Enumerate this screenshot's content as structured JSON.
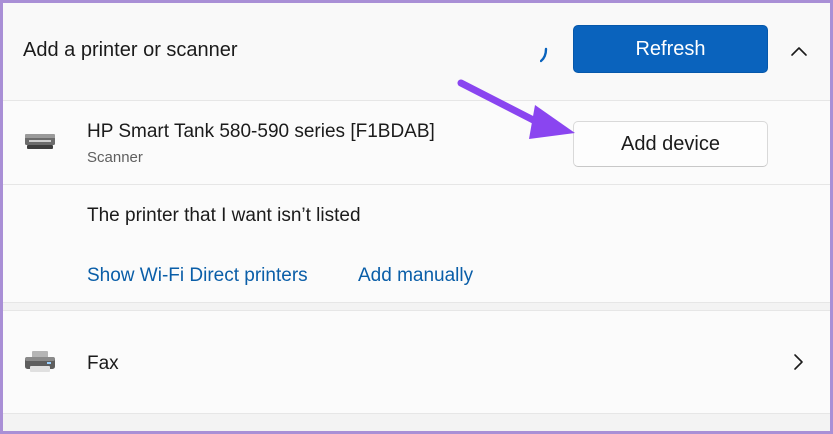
{
  "section": {
    "title": "Add a printer or scanner",
    "refresh_label": "Refresh",
    "collapse_icon": "chevron-up-icon"
  },
  "device": {
    "name": "HP Smart Tank 580-590 series [F1BDAB]",
    "type": "Scanner",
    "add_label": "Add device",
    "icon": "scanner-icon"
  },
  "not_listed": {
    "text": "The printer that I want isn’t listed",
    "links": [
      "Show Wi-Fi Direct printers",
      "Add manually"
    ]
  },
  "fax": {
    "label": "Fax",
    "icon": "fax-icon"
  },
  "colors": {
    "accent": "#0a63bd",
    "link": "#0a5ea8",
    "annotation_arrow": "#8a45f0"
  }
}
